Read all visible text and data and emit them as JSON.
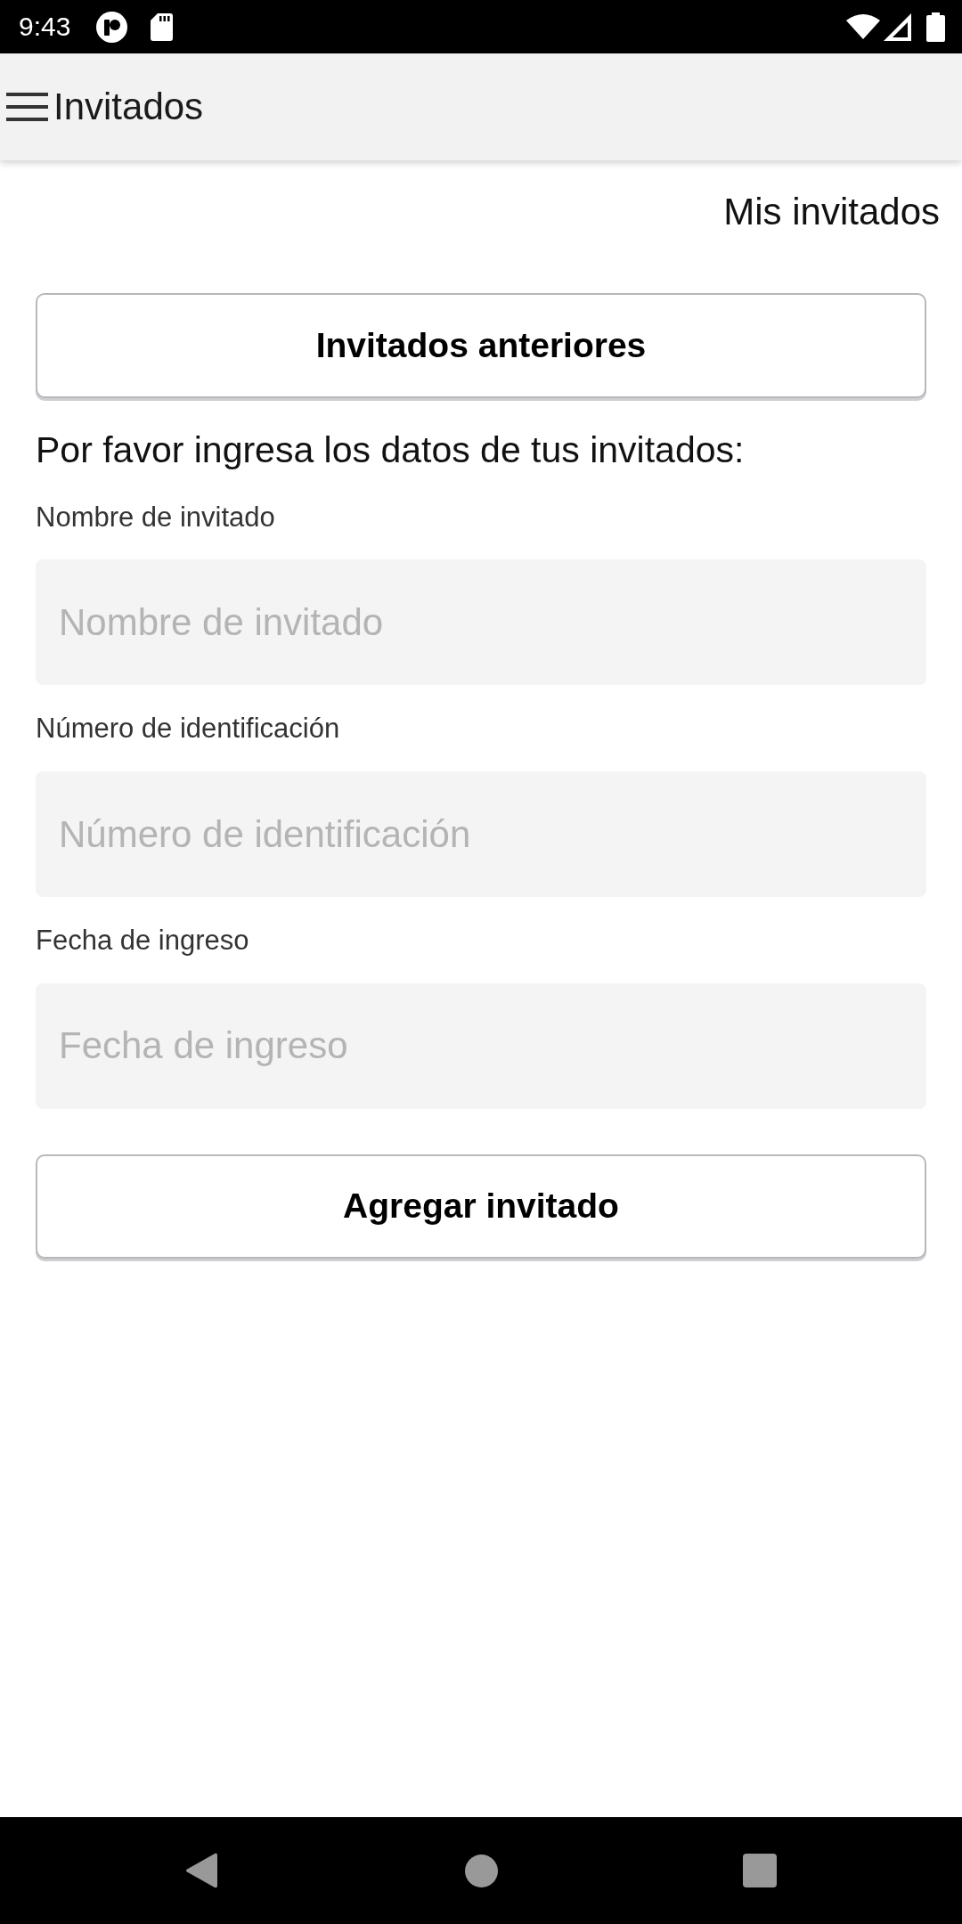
{
  "status_bar": {
    "time": "9:43"
  },
  "app_bar": {
    "title": "Invitados"
  },
  "header_link": "Mis invitados",
  "previous_button": "Invitados anteriores",
  "instructions": "Por favor ingresa los datos de tus invitados:",
  "fields": [
    {
      "label": "Nombre de invitado",
      "placeholder": "Nombre de invitado"
    },
    {
      "label": "Número de identificación",
      "placeholder": "Número de identificación"
    },
    {
      "label": "Fecha de ingreso",
      "placeholder": "Fecha de ingreso"
    }
  ],
  "add_button": "Agregar invitado"
}
